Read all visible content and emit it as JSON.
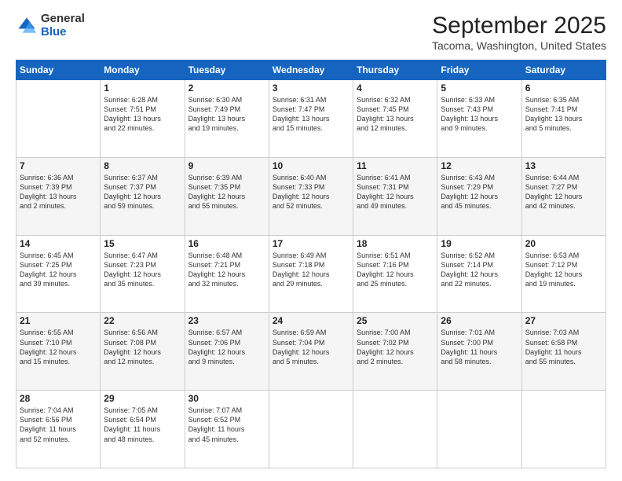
{
  "logo": {
    "general": "General",
    "blue": "Blue"
  },
  "title": "September 2025",
  "location": "Tacoma, Washington, United States",
  "weekdays": [
    "Sunday",
    "Monday",
    "Tuesday",
    "Wednesday",
    "Thursday",
    "Friday",
    "Saturday"
  ],
  "weeks": [
    [
      {
        "day": "",
        "info": ""
      },
      {
        "day": "1",
        "info": "Sunrise: 6:28 AM\nSunset: 7:51 PM\nDaylight: 13 hours\nand 22 minutes."
      },
      {
        "day": "2",
        "info": "Sunrise: 6:30 AM\nSunset: 7:49 PM\nDaylight: 13 hours\nand 19 minutes."
      },
      {
        "day": "3",
        "info": "Sunrise: 6:31 AM\nSunset: 7:47 PM\nDaylight: 13 hours\nand 15 minutes."
      },
      {
        "day": "4",
        "info": "Sunrise: 6:32 AM\nSunset: 7:45 PM\nDaylight: 13 hours\nand 12 minutes."
      },
      {
        "day": "5",
        "info": "Sunrise: 6:33 AM\nSunset: 7:43 PM\nDaylight: 13 hours\nand 9 minutes."
      },
      {
        "day": "6",
        "info": "Sunrise: 6:35 AM\nSunset: 7:41 PM\nDaylight: 13 hours\nand 5 minutes."
      }
    ],
    [
      {
        "day": "7",
        "info": "Sunrise: 6:36 AM\nSunset: 7:39 PM\nDaylight: 13 hours\nand 2 minutes."
      },
      {
        "day": "8",
        "info": "Sunrise: 6:37 AM\nSunset: 7:37 PM\nDaylight: 12 hours\nand 59 minutes."
      },
      {
        "day": "9",
        "info": "Sunrise: 6:39 AM\nSunset: 7:35 PM\nDaylight: 12 hours\nand 55 minutes."
      },
      {
        "day": "10",
        "info": "Sunrise: 6:40 AM\nSunset: 7:33 PM\nDaylight: 12 hours\nand 52 minutes."
      },
      {
        "day": "11",
        "info": "Sunrise: 6:41 AM\nSunset: 7:31 PM\nDaylight: 12 hours\nand 49 minutes."
      },
      {
        "day": "12",
        "info": "Sunrise: 6:43 AM\nSunset: 7:29 PM\nDaylight: 12 hours\nand 45 minutes."
      },
      {
        "day": "13",
        "info": "Sunrise: 6:44 AM\nSunset: 7:27 PM\nDaylight: 12 hours\nand 42 minutes."
      }
    ],
    [
      {
        "day": "14",
        "info": "Sunrise: 6:45 AM\nSunset: 7:25 PM\nDaylight: 12 hours\nand 39 minutes."
      },
      {
        "day": "15",
        "info": "Sunrise: 6:47 AM\nSunset: 7:23 PM\nDaylight: 12 hours\nand 35 minutes."
      },
      {
        "day": "16",
        "info": "Sunrise: 6:48 AM\nSunset: 7:21 PM\nDaylight: 12 hours\nand 32 minutes."
      },
      {
        "day": "17",
        "info": "Sunrise: 6:49 AM\nSunset: 7:18 PM\nDaylight: 12 hours\nand 29 minutes."
      },
      {
        "day": "18",
        "info": "Sunrise: 6:51 AM\nSunset: 7:16 PM\nDaylight: 12 hours\nand 25 minutes."
      },
      {
        "day": "19",
        "info": "Sunrise: 6:52 AM\nSunset: 7:14 PM\nDaylight: 12 hours\nand 22 minutes."
      },
      {
        "day": "20",
        "info": "Sunrise: 6:53 AM\nSunset: 7:12 PM\nDaylight: 12 hours\nand 19 minutes."
      }
    ],
    [
      {
        "day": "21",
        "info": "Sunrise: 6:55 AM\nSunset: 7:10 PM\nDaylight: 12 hours\nand 15 minutes."
      },
      {
        "day": "22",
        "info": "Sunrise: 6:56 AM\nSunset: 7:08 PM\nDaylight: 12 hours\nand 12 minutes."
      },
      {
        "day": "23",
        "info": "Sunrise: 6:57 AM\nSunset: 7:06 PM\nDaylight: 12 hours\nand 9 minutes."
      },
      {
        "day": "24",
        "info": "Sunrise: 6:59 AM\nSunset: 7:04 PM\nDaylight: 12 hours\nand 5 minutes."
      },
      {
        "day": "25",
        "info": "Sunrise: 7:00 AM\nSunset: 7:02 PM\nDaylight: 12 hours\nand 2 minutes."
      },
      {
        "day": "26",
        "info": "Sunrise: 7:01 AM\nSunset: 7:00 PM\nDaylight: 11 hours\nand 58 minutes."
      },
      {
        "day": "27",
        "info": "Sunrise: 7:03 AM\nSunset: 6:58 PM\nDaylight: 11 hours\nand 55 minutes."
      }
    ],
    [
      {
        "day": "28",
        "info": "Sunrise: 7:04 AM\nSunset: 6:56 PM\nDaylight: 11 hours\nand 52 minutes."
      },
      {
        "day": "29",
        "info": "Sunrise: 7:05 AM\nSunset: 6:54 PM\nDaylight: 11 hours\nand 48 minutes."
      },
      {
        "day": "30",
        "info": "Sunrise: 7:07 AM\nSunset: 6:52 PM\nDaylight: 11 hours\nand 45 minutes."
      },
      {
        "day": "",
        "info": ""
      },
      {
        "day": "",
        "info": ""
      },
      {
        "day": "",
        "info": ""
      },
      {
        "day": "",
        "info": ""
      }
    ]
  ]
}
